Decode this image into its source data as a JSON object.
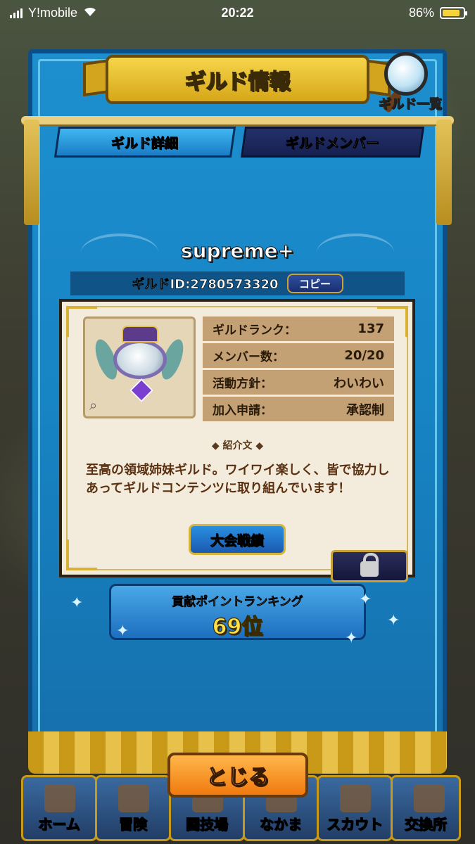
{
  "status_bar": {
    "carrier": "Y!mobile",
    "time": "20:22",
    "battery": "86%"
  },
  "header": {
    "title": "ギルド情報",
    "guild_list_label": "ギルド一覧"
  },
  "tabs": [
    {
      "label": "ギルド詳細",
      "active": true
    },
    {
      "label": "ギルドメンバー",
      "active": false
    }
  ],
  "guild": {
    "name": "supreme+",
    "id_text": "ギルドID:2780573320",
    "copy_label": "コピー",
    "stats": [
      {
        "label": "ギルドランク：",
        "value": "137"
      },
      {
        "label": "メンバー数：",
        "value": "20/20"
      },
      {
        "label": "活動方針：",
        "value": "わいわい"
      },
      {
        "label": "加入申請：",
        "value": "承認制"
      }
    ],
    "intro_heading": "紹介文",
    "intro_text": "至高の領域姉妹ギルド。ワイワイ楽しく、皆で協力しあってギルドコンテンツに取り組んでいます！",
    "tournament_label": "大会戦績"
  },
  "ranking": {
    "title": "貢献ポイントランキング",
    "value": "69位"
  },
  "close_label": "とじる",
  "nav": [
    {
      "label": "ホーム"
    },
    {
      "label": "冒険"
    },
    {
      "label": "闘技場"
    },
    {
      "label": "なかま"
    },
    {
      "label": "スカウト"
    },
    {
      "label": "交換所"
    }
  ],
  "colors": {
    "banner_blue": "#1d8fcf",
    "gold": "#d6a719",
    "close_orange": "#f07a10",
    "rank_yellow": "#ffe04a"
  }
}
